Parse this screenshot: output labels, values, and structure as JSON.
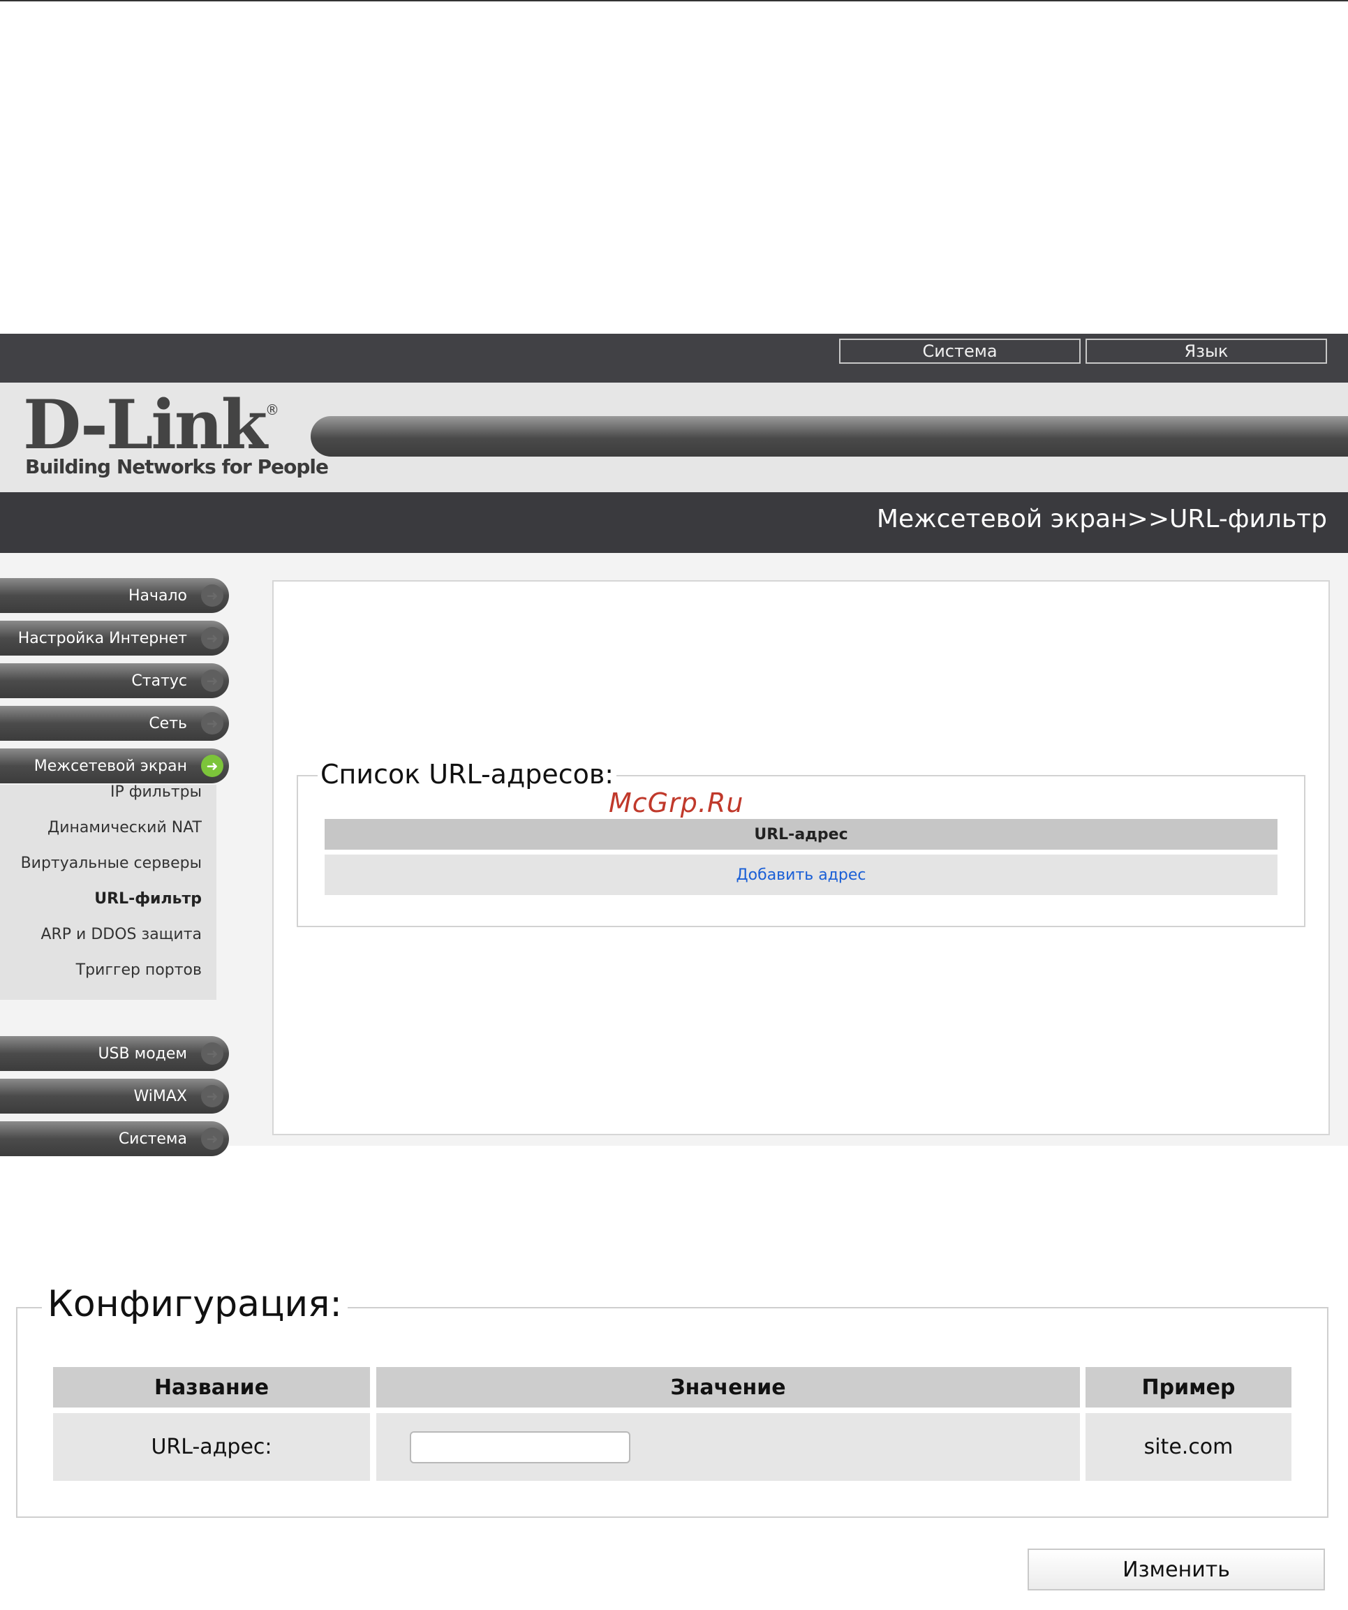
{
  "topbar": {
    "system_label": "Система",
    "language_label": "Язык"
  },
  "logo": {
    "brand": "D-Link",
    "registered": "®",
    "tagline": "Building Networks for People"
  },
  "breadcrumb": "Межсетевой экран>>URL-фильтр",
  "sidebar": {
    "items": [
      {
        "label": "Начало"
      },
      {
        "label": "Настройка Интернет"
      },
      {
        "label": "Статус"
      },
      {
        "label": "Сеть"
      },
      {
        "label": "Межсетевой экран"
      },
      {
        "label": "USB модем"
      },
      {
        "label": "WiMAX"
      },
      {
        "label": "Система"
      }
    ],
    "subitems": [
      {
        "label": "IP фильтры"
      },
      {
        "label": "Динамический NAT"
      },
      {
        "label": "Виртуальные серверы"
      },
      {
        "label": "URL-фильтр"
      },
      {
        "label": "ARP и DDOS защита"
      },
      {
        "label": "Триггер портов"
      }
    ]
  },
  "url_list": {
    "legend": "Список URL-адресов:",
    "column_header": "URL-адрес",
    "add_link": "Добавить адрес"
  },
  "watermark": "McGrp.Ru",
  "config": {
    "legend": "Конфигурация:",
    "headers": {
      "name": "Название",
      "value": "Значение",
      "example": "Пример"
    },
    "row": {
      "name": "URL-адрес:",
      "value": "",
      "example": "site.com"
    },
    "submit_label": "Изменить"
  },
  "colors": {
    "active_arrow": "#7cc43a",
    "link": "#1a5fd6",
    "watermark": "#c0392b"
  }
}
